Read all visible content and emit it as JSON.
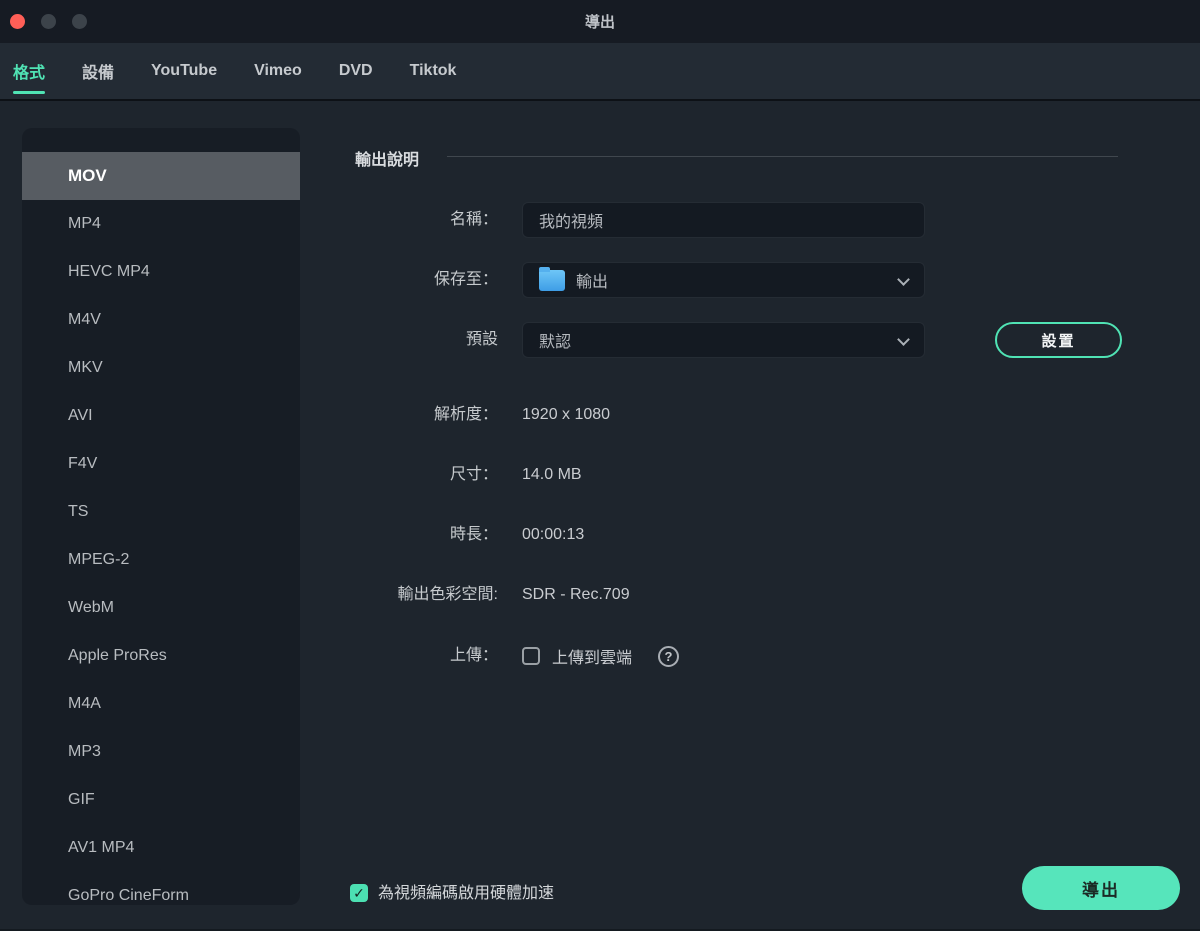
{
  "window": {
    "title": "導出"
  },
  "tabs": [
    {
      "label": "格式",
      "active": true
    },
    {
      "label": "設備",
      "active": false
    },
    {
      "label": "YouTube",
      "active": false
    },
    {
      "label": "Vimeo",
      "active": false
    },
    {
      "label": "DVD",
      "active": false
    },
    {
      "label": "Tiktok",
      "active": false
    }
  ],
  "sidebar": {
    "selected": "MOV",
    "formats": [
      "MOV",
      "MP4",
      "HEVC MP4",
      "M4V",
      "MKV",
      "AVI",
      "F4V",
      "TS",
      "MPEG-2",
      "WebM",
      "Apple ProRes",
      "M4A",
      "MP3",
      "GIF",
      "AV1 MP4",
      "GoPro CineForm"
    ]
  },
  "form": {
    "section_title": "輸出說明",
    "name": {
      "label": "名稱：",
      "value": "我的視頻"
    },
    "save_to": {
      "label": "保存至：",
      "value": "輸出",
      "icon": "folder-icon"
    },
    "preset": {
      "label": "預設",
      "value": "默認",
      "settings_button": "設置"
    },
    "resolution": {
      "label": "解析度：",
      "value": "1920 x 1080"
    },
    "size": {
      "label": "尺寸：",
      "value": "14.0 MB"
    },
    "duration": {
      "label": "時長：",
      "value": "00:00:13"
    },
    "color_space": {
      "label": "輸出色彩空間:",
      "value": "SDR - Rec.709"
    },
    "upload": {
      "label": "上傳：",
      "checkbox_label": "上傳到雲端",
      "checked": false,
      "help_glyph": "?"
    }
  },
  "footer": {
    "hw_accel": {
      "label": "為視頻編碼啟用硬體加速",
      "checked": true,
      "check_glyph": "✓"
    },
    "export_button": "導出"
  },
  "colors": {
    "accent_teal": "#50e3b4",
    "export_fill": "#56e5bb",
    "folder_blue": "#55b0ee",
    "selected_row_gray": "#575c62",
    "titlebar_bg": "#161b23",
    "tabbar_bg": "#232b34",
    "content_bg": "#1e252d",
    "panel_bg": "#171d25",
    "field_bg": "#141a22",
    "close_red": "#ff5f57"
  }
}
